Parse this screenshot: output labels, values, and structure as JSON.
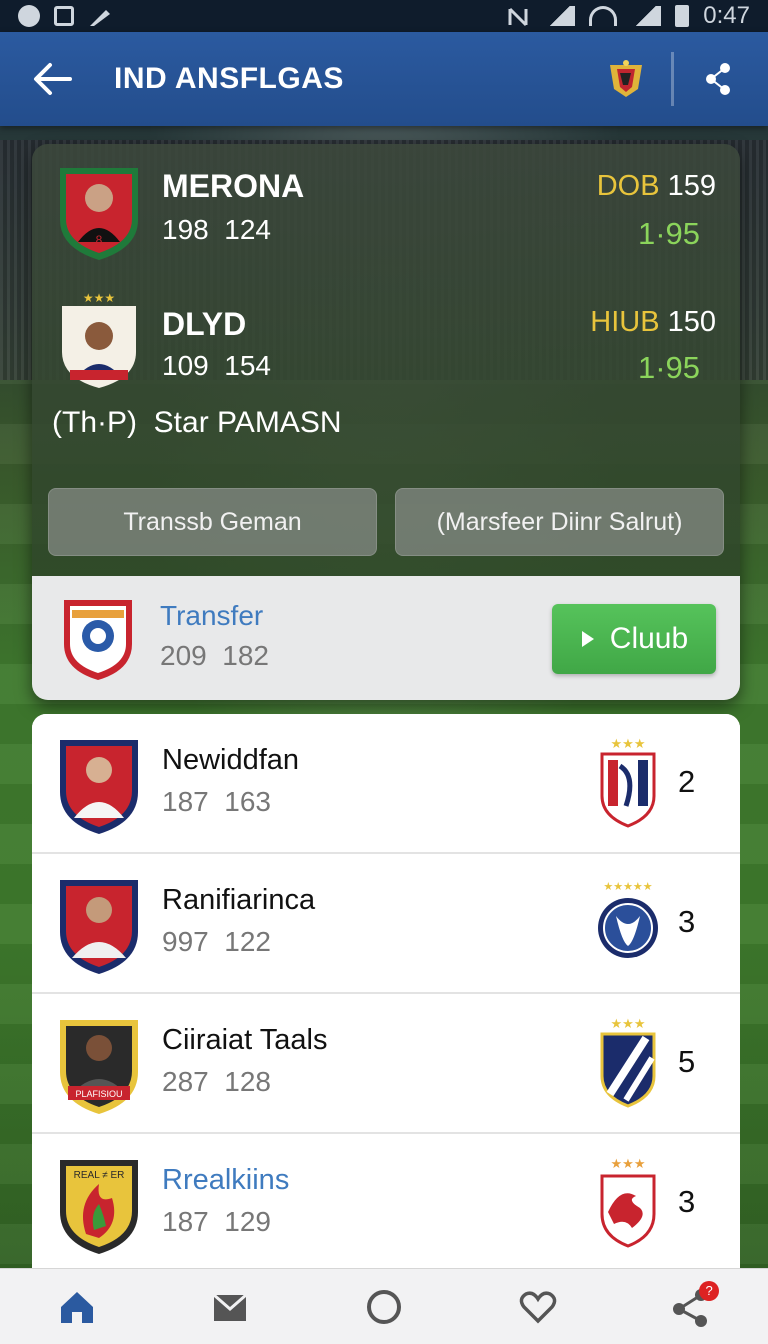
{
  "status_bar": {
    "time": "0:47"
  },
  "app_bar": {
    "title": "IND ANSFLGAS"
  },
  "match": {
    "home": {
      "name": "MERONA",
      "num1": "198",
      "num2": "124",
      "odds_label": "DOB",
      "odds_value": "159",
      "odds": "1·95"
    },
    "away": {
      "name": "DLYD",
      "num1": "109",
      "num2": "154",
      "odds_label": "HIUB",
      "odds_value": "150",
      "odds": "1·95"
    },
    "star_prefix": "(Th·P)",
    "star_text": "Star PAMASN",
    "buttons": {
      "left": "Transsb Geman",
      "right": "(Marsfeer Diinr Salrut)"
    },
    "transfer": {
      "label": "Transfer",
      "num1": "209",
      "num2": "182",
      "button": "Cluub"
    }
  },
  "list": [
    {
      "name": "Newiddfan",
      "num1": "187",
      "num2": "163",
      "rank": "2",
      "highlight": false
    },
    {
      "name": "Ranifiarinca",
      "num1": "997",
      "num2": "122",
      "rank": "3",
      "highlight": false
    },
    {
      "name": "Ciiraiat Taals",
      "num1": "287",
      "num2": "128",
      "rank": "5",
      "highlight": false
    },
    {
      "name": "Rrealkiins",
      "num1": "187",
      "num2": "129",
      "rank": "3",
      "highlight": true
    }
  ],
  "nav": {
    "badge": "?"
  },
  "crest_text": {
    "list3": "PLAFISIOU",
    "list4": "REAL ≠ ER"
  },
  "colors": {
    "primary": "#2b5aa0",
    "accent_green": "#4cb552",
    "odds_gold": "#e8c43c",
    "odds_green": "#8bd45b",
    "link_blue": "#3f7bbf"
  }
}
